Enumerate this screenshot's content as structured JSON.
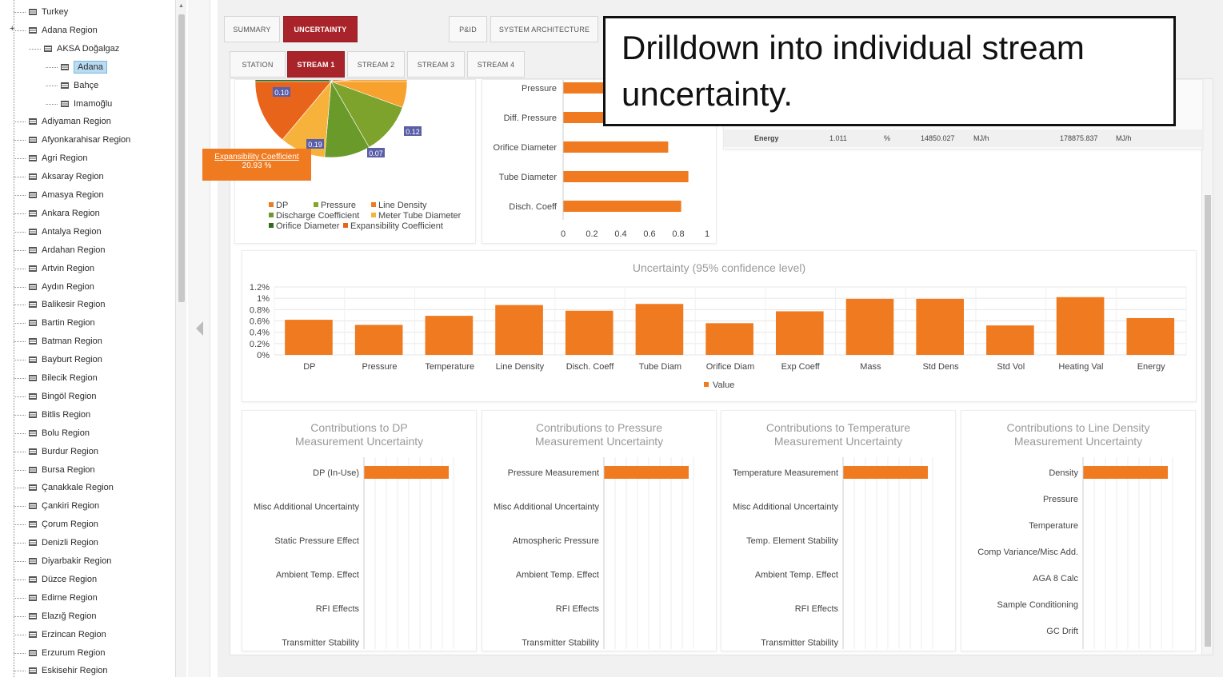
{
  "tree": {
    "items": [
      {
        "label": "Turkey",
        "level": 0
      },
      {
        "label": "Adana Region",
        "level": 0
      },
      {
        "label": "AKSA Doğalgaz",
        "level": 1
      },
      {
        "label": "Adana",
        "level": 2,
        "selected": true
      },
      {
        "label": "Bahçe",
        "level": 2
      },
      {
        "label": "Imamoğlu",
        "level": 2
      },
      {
        "label": "Adiyaman Region",
        "level": 0
      },
      {
        "label": "Afyonkarahisar Region",
        "level": 0
      },
      {
        "label": "Agri Region",
        "level": 0
      },
      {
        "label": "Aksaray Region",
        "level": 0
      },
      {
        "label": "Amasya Region",
        "level": 0
      },
      {
        "label": "Ankara Region",
        "level": 0
      },
      {
        "label": "Antalya Region",
        "level": 0
      },
      {
        "label": "Ardahan Region",
        "level": 0
      },
      {
        "label": "Artvin Region",
        "level": 0
      },
      {
        "label": "Aydın Region",
        "level": 0
      },
      {
        "label": "Balikesir Region",
        "level": 0
      },
      {
        "label": "Bartin Region",
        "level": 0
      },
      {
        "label": "Batman Region",
        "level": 0
      },
      {
        "label": "Bayburt Region",
        "level": 0
      },
      {
        "label": "Bilecik Region",
        "level": 0
      },
      {
        "label": "Bingöl Region",
        "level": 0
      },
      {
        "label": "Bitlis Region",
        "level": 0
      },
      {
        "label": "Bolu Region",
        "level": 0
      },
      {
        "label": "Burdur Region",
        "level": 0
      },
      {
        "label": "Bursa Region",
        "level": 0
      },
      {
        "label": "Çanakkale Region",
        "level": 0
      },
      {
        "label": "Çankiri Region",
        "level": 0
      },
      {
        "label": "Çorum Region",
        "level": 0
      },
      {
        "label": "Denizli Region",
        "level": 0
      },
      {
        "label": "Diyarbakir Region",
        "level": 0
      },
      {
        "label": "Düzce Region",
        "level": 0
      },
      {
        "label": "Edirne Region",
        "level": 0
      },
      {
        "label": "Elazığ Region",
        "level": 0
      },
      {
        "label": "Erzincan Region",
        "level": 0
      },
      {
        "label": "Erzurum Region",
        "level": 0
      },
      {
        "label": "Eskisehir Region",
        "level": 0
      }
    ]
  },
  "tabs": {
    "top": [
      "SUMMARY",
      "UNCERTAINTY",
      "P&ID",
      "SYSTEM ARCHITECTURE"
    ],
    "top_active": "UNCERTAINTY",
    "sub": [
      "STATION",
      "STREAM 1",
      "STREAM 2",
      "STREAM 3",
      "STREAM 4"
    ],
    "sub_active": "STREAM 1"
  },
  "callout": {
    "text": "Drilldown into individual stream uncertainty."
  },
  "tooltip": {
    "line1": "Expansibility Coefficient",
    "line2": "20.93 %"
  },
  "colors": {
    "accent": "#a8242a",
    "orange": "#f07a1f",
    "dark_green": "#2e6b1f",
    "olive_green": "#86a52a",
    "light_orange": "#f7b23b"
  },
  "energy_row": {
    "label": "Energy",
    "value": "1.011",
    "unit": "%",
    "flow": "14850.027",
    "flow_unit": "MJ/h",
    "total": "178875.837",
    "total_unit": "MJ/h"
  },
  "chart_data": [
    {
      "type": "pie",
      "title": "",
      "slices": [
        {
          "name": "DP",
          "value": null,
          "color": "#f07a1f"
        },
        {
          "name": "Pressure",
          "value": null,
          "color": "#86a52a"
        },
        {
          "name": "Line Density",
          "value": null,
          "color": "#f07a1f"
        },
        {
          "name": "Discharge Coefficient",
          "value": null,
          "color": "#6a9a2a"
        },
        {
          "name": "Meter Tube Diameter",
          "value": null,
          "color": "#f7b23b"
        },
        {
          "name": "Orifice Diameter",
          "value": 0.1,
          "color": "#2e6b1f"
        },
        {
          "name": "Expansibility Coefficient",
          "value": 20.93,
          "color": "#e8641a"
        }
      ],
      "labels_visible": [
        "0.10",
        "0.12",
        "0.19",
        "0.07"
      ],
      "legend": [
        "DP",
        "Pressure",
        "Line Density",
        "Discharge Coefficient",
        "Meter Tube Diameter",
        "Orifice Diameter",
        "Expansibility Coefficient"
      ]
    },
    {
      "type": "bar",
      "orientation": "horizontal",
      "categories": [
        "Pressure",
        "Diff. Pressure",
        "Orifice Diameter",
        "Tube Diameter",
        "Disch. Coeff"
      ],
      "values": [
        0.7,
        0.75,
        0.73,
        0.87,
        0.82
      ],
      "xlim": [
        0,
        1
      ],
      "xticks": [
        "0",
        "0.2",
        "0.4",
        "0.6",
        "0.8",
        "1"
      ]
    },
    {
      "type": "bar",
      "title": "Uncertainty (95% confidence level)",
      "categories": [
        "DP",
        "Pressure",
        "Temperature",
        "Line Density",
        "Disch. Coeff",
        "Tube Diam",
        "Orifice Diam",
        "Exp Coeff",
        "Mass",
        "Std Dens",
        "Std Vol",
        "Heating Val",
        "Energy"
      ],
      "series": [
        {
          "name": "Value",
          "values": [
            0.62,
            0.53,
            0.69,
            0.88,
            0.78,
            0.9,
            0.56,
            0.77,
            0.99,
            0.99,
            0.52,
            1.02,
            0.65
          ]
        }
      ],
      "ylim": [
        0,
        1.2
      ],
      "yticks": [
        "0%",
        "0.2%",
        "0.4%",
        "0.6%",
        "0.8%",
        "1%",
        "1.2%"
      ]
    },
    {
      "type": "bar",
      "orientation": "horizontal",
      "title": "Contributions to DP Measurement Uncertainty",
      "categories": [
        "DP (In-Use)",
        "Misc Additional Uncertainty",
        "Static Pressure Effect",
        "Ambient Temp. Effect",
        "RFI Effects",
        "Transmitter Stability"
      ],
      "values": [
        100,
        0,
        0,
        0,
        0,
        0
      ]
    },
    {
      "type": "bar",
      "orientation": "horizontal",
      "title": "Contributions to Pressure Measurement Uncertainty",
      "categories": [
        "Pressure Measurement",
        "Misc Additional Uncertainty",
        "Atmospheric Pressure",
        "Ambient Temp. Effect",
        "RFI Effects",
        "Transmitter Stability"
      ],
      "values": [
        100,
        0,
        0,
        0,
        0,
        0
      ]
    },
    {
      "type": "bar",
      "orientation": "horizontal",
      "title": "Contributions to Temperature Measurement Uncertainty",
      "categories": [
        "Temperature Measurement",
        "Misc Additional Uncertainty",
        "Temp. Element Stability",
        "Ambient Temp. Effect",
        "RFI Effects",
        "Transmitter Stability"
      ],
      "values": [
        100,
        0,
        0,
        0,
        0,
        0
      ]
    },
    {
      "type": "bar",
      "orientation": "horizontal",
      "title": "Contributions to Line Density Measurement Uncertainty",
      "categories": [
        "Density",
        "Pressure",
        "Temperature",
        "Comp Variance/Misc Add.",
        "AGA 8 Calc",
        "Sample Conditioning",
        "GC Drift"
      ],
      "values": [
        100,
        0,
        0,
        0,
        0,
        0,
        0
      ]
    }
  ]
}
